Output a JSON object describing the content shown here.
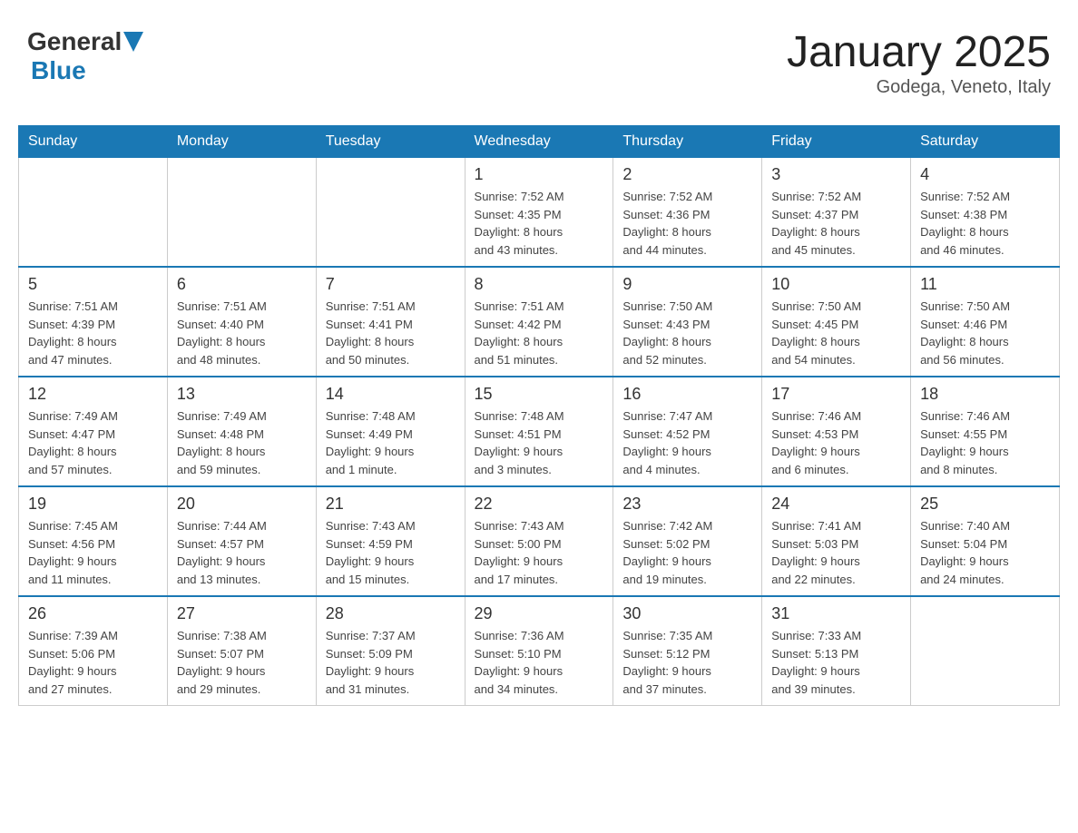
{
  "header": {
    "logo_general": "General",
    "logo_blue": "Blue",
    "month_title": "January 2025",
    "location": "Godega, Veneto, Italy"
  },
  "days_of_week": [
    "Sunday",
    "Monday",
    "Tuesday",
    "Wednesday",
    "Thursday",
    "Friday",
    "Saturday"
  ],
  "weeks": [
    [
      {
        "day": "",
        "info": ""
      },
      {
        "day": "",
        "info": ""
      },
      {
        "day": "",
        "info": ""
      },
      {
        "day": "1",
        "info": "Sunrise: 7:52 AM\nSunset: 4:35 PM\nDaylight: 8 hours\nand 43 minutes."
      },
      {
        "day": "2",
        "info": "Sunrise: 7:52 AM\nSunset: 4:36 PM\nDaylight: 8 hours\nand 44 minutes."
      },
      {
        "day": "3",
        "info": "Sunrise: 7:52 AM\nSunset: 4:37 PM\nDaylight: 8 hours\nand 45 minutes."
      },
      {
        "day": "4",
        "info": "Sunrise: 7:52 AM\nSunset: 4:38 PM\nDaylight: 8 hours\nand 46 minutes."
      }
    ],
    [
      {
        "day": "5",
        "info": "Sunrise: 7:51 AM\nSunset: 4:39 PM\nDaylight: 8 hours\nand 47 minutes."
      },
      {
        "day": "6",
        "info": "Sunrise: 7:51 AM\nSunset: 4:40 PM\nDaylight: 8 hours\nand 48 minutes."
      },
      {
        "day": "7",
        "info": "Sunrise: 7:51 AM\nSunset: 4:41 PM\nDaylight: 8 hours\nand 50 minutes."
      },
      {
        "day": "8",
        "info": "Sunrise: 7:51 AM\nSunset: 4:42 PM\nDaylight: 8 hours\nand 51 minutes."
      },
      {
        "day": "9",
        "info": "Sunrise: 7:50 AM\nSunset: 4:43 PM\nDaylight: 8 hours\nand 52 minutes."
      },
      {
        "day": "10",
        "info": "Sunrise: 7:50 AM\nSunset: 4:45 PM\nDaylight: 8 hours\nand 54 minutes."
      },
      {
        "day": "11",
        "info": "Sunrise: 7:50 AM\nSunset: 4:46 PM\nDaylight: 8 hours\nand 56 minutes."
      }
    ],
    [
      {
        "day": "12",
        "info": "Sunrise: 7:49 AM\nSunset: 4:47 PM\nDaylight: 8 hours\nand 57 minutes."
      },
      {
        "day": "13",
        "info": "Sunrise: 7:49 AM\nSunset: 4:48 PM\nDaylight: 8 hours\nand 59 minutes."
      },
      {
        "day": "14",
        "info": "Sunrise: 7:48 AM\nSunset: 4:49 PM\nDaylight: 9 hours\nand 1 minute."
      },
      {
        "day": "15",
        "info": "Sunrise: 7:48 AM\nSunset: 4:51 PM\nDaylight: 9 hours\nand 3 minutes."
      },
      {
        "day": "16",
        "info": "Sunrise: 7:47 AM\nSunset: 4:52 PM\nDaylight: 9 hours\nand 4 minutes."
      },
      {
        "day": "17",
        "info": "Sunrise: 7:46 AM\nSunset: 4:53 PM\nDaylight: 9 hours\nand 6 minutes."
      },
      {
        "day": "18",
        "info": "Sunrise: 7:46 AM\nSunset: 4:55 PM\nDaylight: 9 hours\nand 8 minutes."
      }
    ],
    [
      {
        "day": "19",
        "info": "Sunrise: 7:45 AM\nSunset: 4:56 PM\nDaylight: 9 hours\nand 11 minutes."
      },
      {
        "day": "20",
        "info": "Sunrise: 7:44 AM\nSunset: 4:57 PM\nDaylight: 9 hours\nand 13 minutes."
      },
      {
        "day": "21",
        "info": "Sunrise: 7:43 AM\nSunset: 4:59 PM\nDaylight: 9 hours\nand 15 minutes."
      },
      {
        "day": "22",
        "info": "Sunrise: 7:43 AM\nSunset: 5:00 PM\nDaylight: 9 hours\nand 17 minutes."
      },
      {
        "day": "23",
        "info": "Sunrise: 7:42 AM\nSunset: 5:02 PM\nDaylight: 9 hours\nand 19 minutes."
      },
      {
        "day": "24",
        "info": "Sunrise: 7:41 AM\nSunset: 5:03 PM\nDaylight: 9 hours\nand 22 minutes."
      },
      {
        "day": "25",
        "info": "Sunrise: 7:40 AM\nSunset: 5:04 PM\nDaylight: 9 hours\nand 24 minutes."
      }
    ],
    [
      {
        "day": "26",
        "info": "Sunrise: 7:39 AM\nSunset: 5:06 PM\nDaylight: 9 hours\nand 27 minutes."
      },
      {
        "day": "27",
        "info": "Sunrise: 7:38 AM\nSunset: 5:07 PM\nDaylight: 9 hours\nand 29 minutes."
      },
      {
        "day": "28",
        "info": "Sunrise: 7:37 AM\nSunset: 5:09 PM\nDaylight: 9 hours\nand 31 minutes."
      },
      {
        "day": "29",
        "info": "Sunrise: 7:36 AM\nSunset: 5:10 PM\nDaylight: 9 hours\nand 34 minutes."
      },
      {
        "day": "30",
        "info": "Sunrise: 7:35 AM\nSunset: 5:12 PM\nDaylight: 9 hours\nand 37 minutes."
      },
      {
        "day": "31",
        "info": "Sunrise: 7:33 AM\nSunset: 5:13 PM\nDaylight: 9 hours\nand 39 minutes."
      },
      {
        "day": "",
        "info": ""
      }
    ]
  ]
}
